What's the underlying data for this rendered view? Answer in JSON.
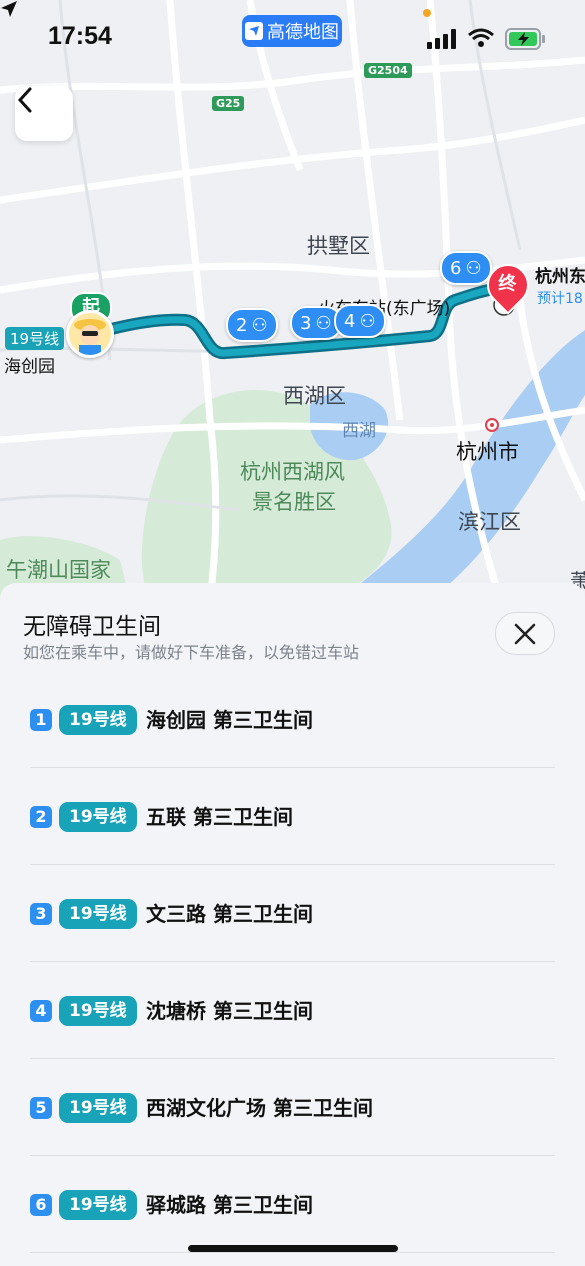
{
  "status": {
    "time": "17:54",
    "app_badge": "高德地图"
  },
  "map": {
    "roads": {
      "g2504": "G2504",
      "g25": "G25"
    },
    "districts": {
      "gongshu": "拱墅区",
      "xihu_district": "西湖区",
      "xihu_lake": "西湖",
      "scenic_line1": "杭州西湖风",
      "scenic_line2": "景名胜区",
      "hangzhou_city": "杭州市",
      "binjiang": "滨江区",
      "wuchao": "午潮山国家",
      "cut_char": "萧"
    },
    "station_labels": {
      "start_line": "19号线",
      "start_station": "海创园",
      "east_station": "火车东站(东广场)",
      "hangzhou_east": "杭州东",
      "eta": "预计18"
    },
    "markers": {
      "start": "起",
      "end": "终",
      "m2": "2",
      "m3": "3",
      "m4": "4",
      "m6": "6"
    }
  },
  "sheet": {
    "title": "无障碍卫生间",
    "subtitle": "如您在乘车中，请做好下车准备，以免错过车站",
    "items": [
      {
        "num": "1",
        "line": "19号线",
        "station": "海创园 第三卫生间"
      },
      {
        "num": "2",
        "line": "19号线",
        "station": "五联 第三卫生间"
      },
      {
        "num": "3",
        "line": "19号线",
        "station": "文三路 第三卫生间"
      },
      {
        "num": "4",
        "line": "19号线",
        "station": "沈塘桥 第三卫生间"
      },
      {
        "num": "5",
        "line": "19号线",
        "station": "西湖文化广场 第三卫生间"
      },
      {
        "num": "6",
        "line": "19号线",
        "station": "驿城路 第三卫生间"
      }
    ]
  },
  "colors": {
    "route": "#1590a8",
    "accent": "#2d8ff0",
    "line_tag": "#19a3b8",
    "end_pin": "#f0324a",
    "start_pin": "#19a263"
  }
}
